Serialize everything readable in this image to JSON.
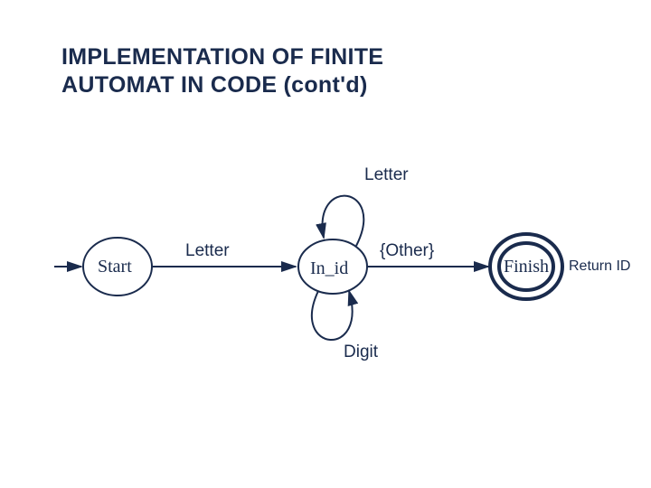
{
  "title_line1": "IMPLEMENTATION OF FINITE",
  "title_line2": "AUTOMAT IN CODE (cont'd)",
  "state_start": "Start",
  "state_in_id": "In_id",
  "state_finish": "Finish",
  "label_letter_top": "Letter",
  "label_letter_trans": "Letter",
  "label_other": "{Other}",
  "label_digit": "Digit",
  "label_return": "Return ID",
  "colors": {
    "ink": "#1a2b4d",
    "bg": "#ffffff"
  }
}
